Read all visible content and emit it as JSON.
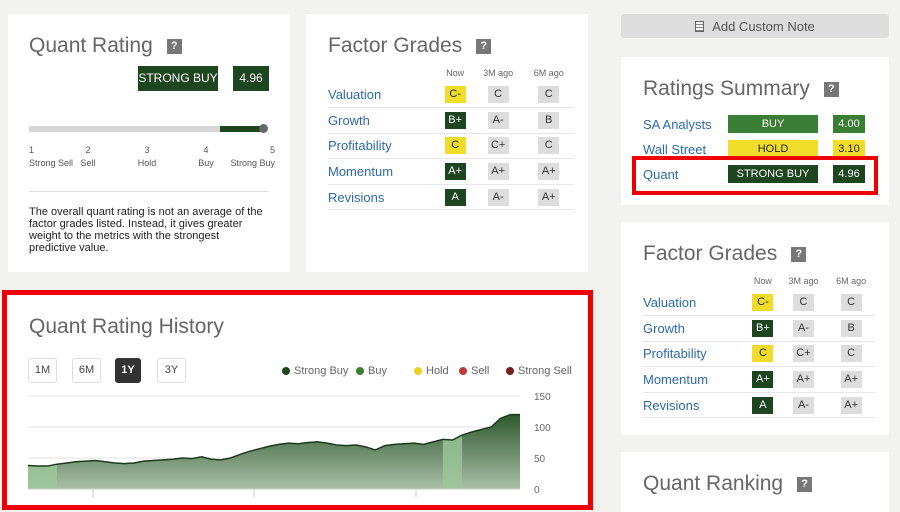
{
  "quant_rating": {
    "title": "Quant Rating",
    "help": "?",
    "rating": "STRONG BUY",
    "score": "4.96",
    "score_value": 4.96,
    "scale": [
      {
        "n": "1",
        "label": "Strong Sell"
      },
      {
        "n": "2",
        "label": "Sell"
      },
      {
        "n": "3",
        "label": "Hold"
      },
      {
        "n": "4",
        "label": "Buy"
      },
      {
        "n": "5",
        "label": "Strong Buy"
      }
    ],
    "note": "The overall quant rating is not an average of the factor grades listed. Instead, it gives greater weight to the metrics with the strongest predictive value."
  },
  "factor_grades": {
    "title": "Factor Grades",
    "help": "?",
    "columns": [
      "Now",
      "3M ago",
      "6M ago"
    ],
    "rows": [
      {
        "name": "Valuation",
        "grades": [
          "C-",
          "C",
          "C"
        ]
      },
      {
        "name": "Growth",
        "grades": [
          "B+",
          "A-",
          "B"
        ]
      },
      {
        "name": "Profitability",
        "grades": [
          "C",
          "C+",
          "C"
        ]
      },
      {
        "name": "Momentum",
        "grades": [
          "A+",
          "A+",
          "A+"
        ]
      },
      {
        "name": "Revisions",
        "grades": [
          "A",
          "A-",
          "A+"
        ]
      }
    ]
  },
  "sidebar": {
    "add_note": "Add Custom Note",
    "note_icon": "document-icon",
    "ratings_summary": {
      "title": "Ratings Summary",
      "help": "?",
      "rows": [
        {
          "source": "SA Analysts",
          "rating": "BUY",
          "score": "4.00",
          "style": "b"
        },
        {
          "source": "Wall Street",
          "rating": "HOLD",
          "score": "3.10",
          "style": "hd"
        },
        {
          "source": "Quant",
          "rating": "STRONG BUY",
          "score": "4.96",
          "style": "sb"
        }
      ]
    },
    "quant_ranking": {
      "title": "Quant Ranking",
      "help": "?"
    }
  },
  "history": {
    "title": "Quant Rating History",
    "ranges": [
      "1M",
      "6M",
      "1Y",
      "3Y"
    ],
    "active_range": "1Y",
    "legend": [
      {
        "label": "Strong Buy",
        "color": "#1d4620"
      },
      {
        "label": "Buy",
        "color": "#3a7d34"
      },
      {
        "label": "Hold",
        "color": "#e8d21f"
      },
      {
        "label": "Sell",
        "color": "#c0393b"
      },
      {
        "label": "Strong Sell",
        "color": "#7a1f1f"
      }
    ]
  },
  "chart_data": {
    "type": "area",
    "ylim": [
      0,
      150
    ],
    "yticks": [
      "150",
      "100",
      "50",
      "0"
    ],
    "grid": true,
    "values": [
      38,
      37,
      37,
      40,
      42,
      44,
      45,
      46,
      44,
      42,
      41,
      42,
      45,
      46,
      47,
      48,
      50,
      49,
      52,
      48,
      47,
      50,
      56,
      61,
      65,
      69,
      72,
      74,
      73,
      75,
      76,
      74,
      71,
      70,
      71,
      68,
      63,
      70,
      72,
      73,
      74,
      72,
      76,
      80,
      79,
      87,
      92,
      96,
      100,
      114,
      120,
      120
    ],
    "buy_periods": [
      [
        0,
        3
      ],
      [
        43,
        45
      ]
    ]
  },
  "colors": {
    "strong_buy": "#1d4620",
    "buy": "#3a7d34",
    "hold": "#f0dd2a",
    "highlight": "#ee0000"
  }
}
